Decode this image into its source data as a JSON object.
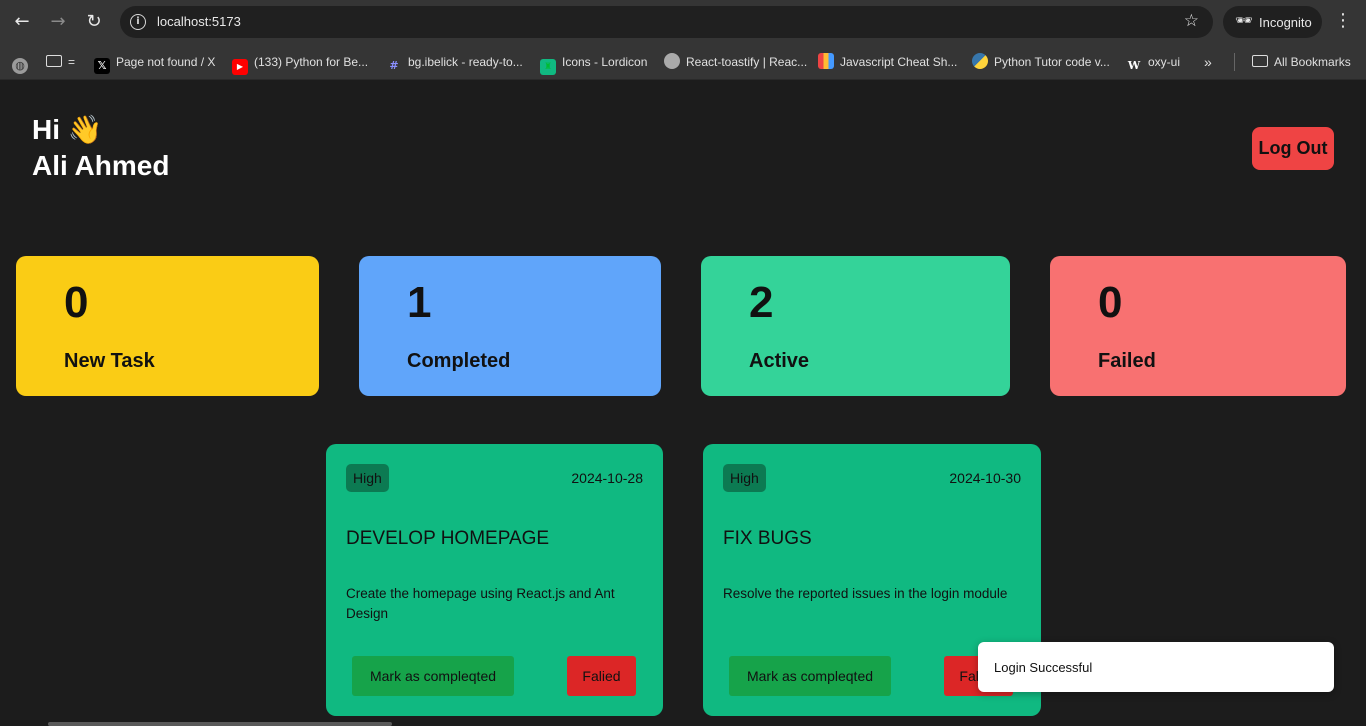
{
  "browser": {
    "url": "localhost:5173",
    "incognito_label": "Incognito",
    "bookmarks": [
      {
        "label": "Page not found / X",
        "icon": "x-logo-icon"
      },
      {
        "label": "(133) Python for Be...",
        "icon": "youtube-icon"
      },
      {
        "label": "bg.ibelick - ready-to...",
        "icon": "hash-icon"
      },
      {
        "label": "Icons - Lordicon",
        "icon": "lordicon-icon"
      },
      {
        "label": "React-toastify | Reac...",
        "icon": "react-toastify-icon"
      },
      {
        "label": "Javascript Cheat Sh...",
        "icon": "cheatsheet-icon"
      },
      {
        "label": "Python Tutor code v...",
        "icon": "python-icon"
      },
      {
        "label": "oxy-ui",
        "icon": "w-icon"
      }
    ],
    "all_bookmarks_label": "All Bookmarks",
    "folder_label": "="
  },
  "header": {
    "hi": "Hi",
    "wave": "👋",
    "name": "Ali Ahmed",
    "logout_label": "Log Out"
  },
  "stats": [
    {
      "count": "0",
      "label": "New Task",
      "color": "#facc15"
    },
    {
      "count": "1",
      "label": "Completed",
      "color": "#60a5fa"
    },
    {
      "count": "2",
      "label": "Active",
      "color": "#34d399"
    },
    {
      "count": "0",
      "label": "Failed",
      "color": "#f87171"
    }
  ],
  "tasks": [
    {
      "priority": "High",
      "date": "2024-10-28",
      "title": "DEVELOP HOMEPAGE",
      "description": "Create the homepage using React.js and Ant Design",
      "complete_label": "Mark as compleqted",
      "failed_label": "Falied"
    },
    {
      "priority": "High",
      "date": "2024-10-30",
      "title": "FIX BUGS",
      "description": "Resolve the reported issues in the login module",
      "complete_label": "Mark as compleqted",
      "failed_label": "Falied"
    }
  ],
  "toast": {
    "message": "Login Successful"
  }
}
